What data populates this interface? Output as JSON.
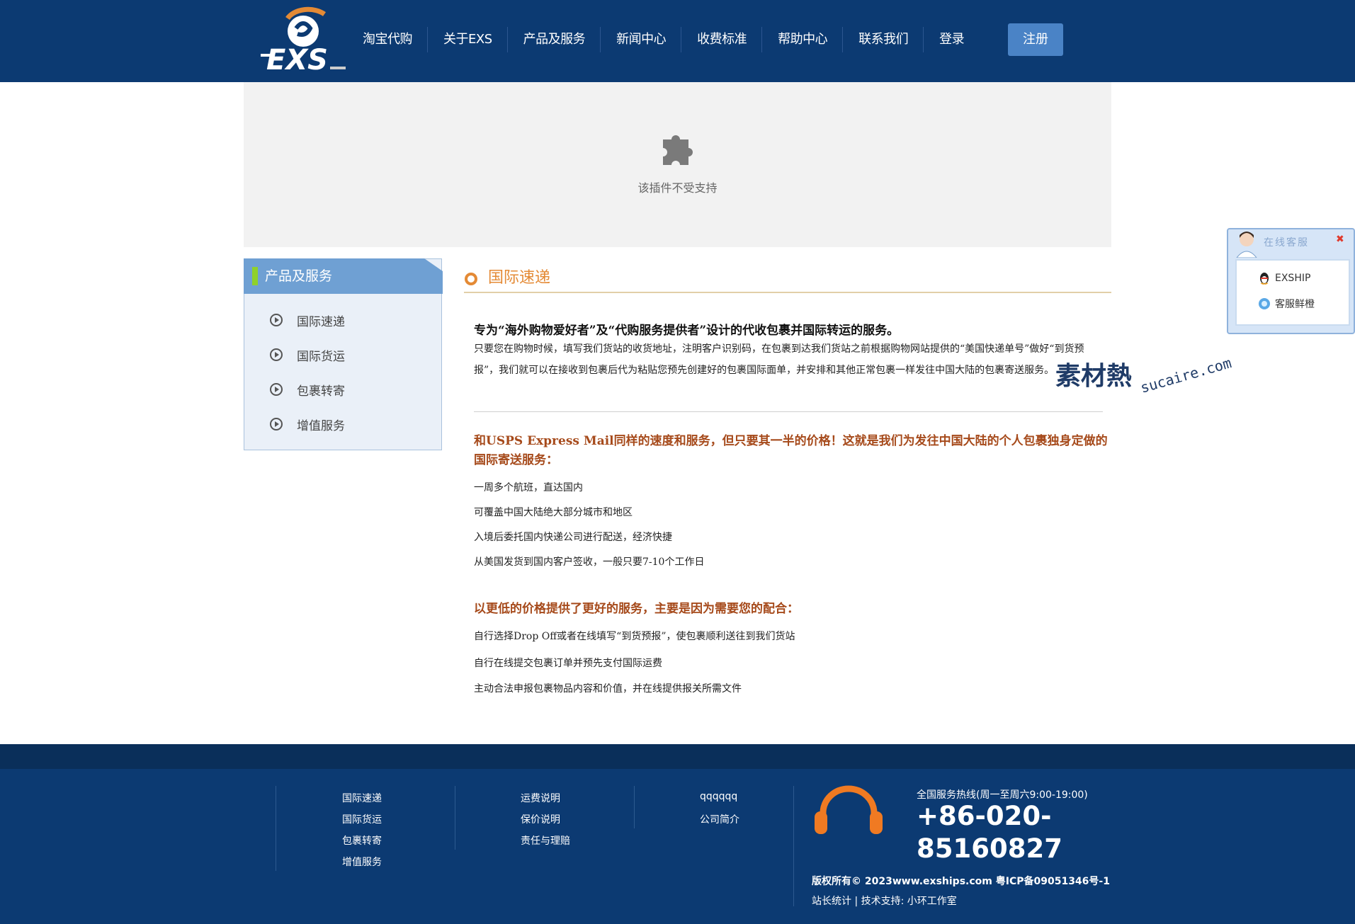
{
  "header": {
    "logo_text": "EXS",
    "nav": [
      "淘宝代购",
      "关于EXS",
      "产品及服务",
      "新闻中心",
      "收费标准",
      "帮助中心",
      "联系我们",
      "登录"
    ],
    "register_label": "注册"
  },
  "plugin": {
    "message": "该插件不受支持"
  },
  "sidebar": {
    "title": "产品及服务",
    "items": [
      "国际速递",
      "国际货运",
      "包裹转寄",
      "增值服务"
    ]
  },
  "main": {
    "title": "国际速递",
    "intro_head": "专为“海外购物爱好者”及“代购服务提供者”设计的代收包裹并国际转运的服务。",
    "intro_body": "只要您在购物时候，填写我们货站的收货地址，注明客户识别码，在包裹到达我们货站之前根据购物网站提供的“美国快递单号”做好“到货预报”，我们就可以在接收到包裹后代为粘贴您预先创建好的包裹国际面单，并安排和其他正常包裹一样发往中国大陆的包裹寄送服务。",
    "section1_head": "和USPS Express Mail同样的速度和服务，但只要其一半的价格！这就是我们为发往中国大陆的个人包裹独身定做的国际寄送服务：",
    "section1_items": [
      "一周多个航班，直达国内",
      "可覆盖中国大陆绝大部分城市和地区",
      "入境后委托国内快递公司进行配送，经济快捷",
      "从美国发货到国内客户签收，一般只要7-10个工作日"
    ],
    "section2_head": "以更低的价格提供了更好的服务，主要是因为需要您的配合：",
    "section2_items": [
      "自行选择Drop Off或者在线填写“到货预报”，使包裹顺利送往到我们货站",
      "自行在线提交包裹订单并预先支付国际运费",
      "主动合法申报包裹物品内容和价值，并在线提供报关所需文件"
    ]
  },
  "watermark": {
    "cn": "素材熱",
    "en": "sucaire.com"
  },
  "online_service": {
    "title": "在线客服",
    "close": "✖",
    "items": [
      "EXSHIP",
      "客服鲜橙"
    ]
  },
  "footer": {
    "col1": [
      "国际速递",
      "国际货运",
      "包裹转寄",
      "增值服务"
    ],
    "col2": [
      "运费说明",
      "保价说明",
      "责任与理赔"
    ],
    "col3": [
      "qqqqqq",
      "公司简介"
    ],
    "hotline_label": "全国服务热线(周一至周六9:00-19:00)",
    "hotline_number": "+86-020-85160827",
    "copyright": "版权所有© 2023www.exships.com 粤ICP备09051346号-1",
    "credits": "站长统计 | 技术支持: 小环工作室"
  },
  "colors": {
    "header_bg": "#0c3a72",
    "accent_orange": "#e48a35",
    "register_btn": "#4a83c6",
    "sidebar_head": "#6fa0d3"
  }
}
